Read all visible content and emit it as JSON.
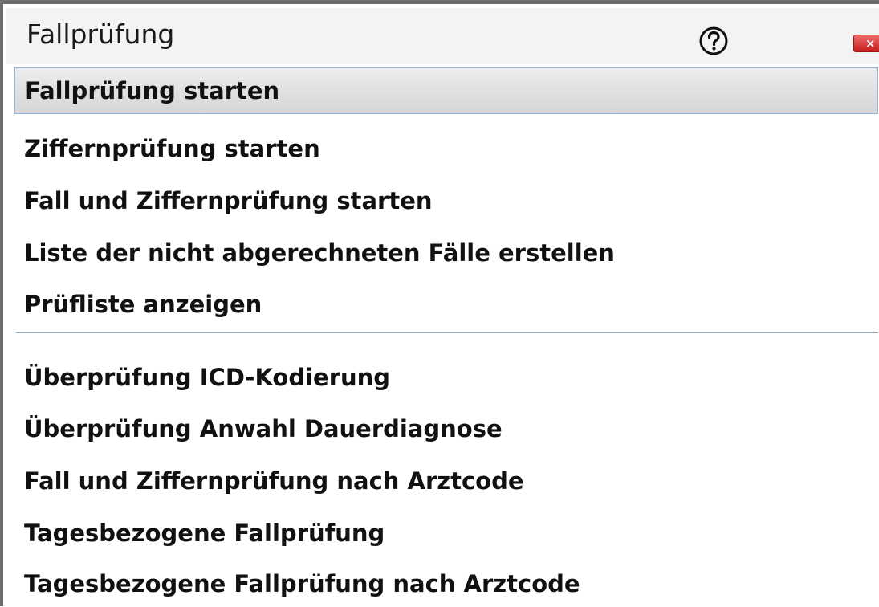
{
  "window": {
    "title": "Fallprüfung",
    "help_icon": "question-circle-icon",
    "close_label": "×",
    "close_color": "#d32f2f"
  },
  "menu": {
    "group1": [
      {
        "label": "Fallprüfung starten",
        "selected": true
      },
      {
        "label": "Ziffernprüfung starten"
      },
      {
        "label": "Fall und Ziffernprüfung starten"
      },
      {
        "label": "Liste der nicht abgerechneten Fälle erstellen"
      },
      {
        "label": "Prüfliste anzeigen"
      }
    ],
    "group2": [
      {
        "label": "Überprüfung ICD-Kodierung"
      },
      {
        "label": "Überprüfung Anwahl Dauerdiagnose"
      },
      {
        "label": "Fall und Ziffernprüfung nach Arztcode"
      },
      {
        "label": "Tagesbezogene Fallprüfung"
      },
      {
        "label": "Tagesbezogene Fallprüfung nach Arztcode"
      }
    ]
  }
}
